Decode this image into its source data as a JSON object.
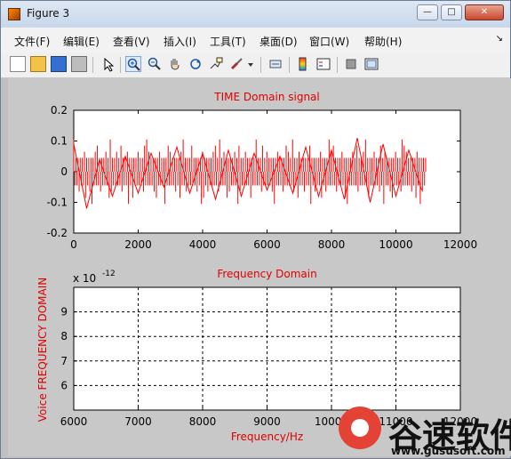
{
  "window": {
    "title": "Figure 3",
    "buttons": {
      "minimize": "—",
      "maximize": "□",
      "close": "✕"
    }
  },
  "menu": {
    "items": [
      "文件(F)",
      "编辑(E)",
      "查看(V)",
      "插入(I)",
      "工具(T)",
      "桌面(D)",
      "窗口(W)",
      "帮助(H)"
    ],
    "corner_icon": "↘"
  },
  "toolbar": {
    "items": [
      "new-file-icon",
      "open-folder-icon",
      "save-icon",
      "print-icon",
      "select-arrow-icon",
      "zoom-in-icon",
      "zoom-out-icon",
      "pan-icon",
      "rotate-icon",
      "data-cursor-icon",
      "brush-icon",
      "dropdown-icon",
      "link-icon",
      "colorbar-icon",
      "legend-icon",
      "hide-tools-icon",
      "dock-icon"
    ]
  },
  "chart_data": [
    {
      "type": "line",
      "title": "TIME Domain signal",
      "xlabel": "",
      "ylabel": "",
      "xlim": [
        0,
        12000
      ],
      "ylim": [
        -0.2,
        0.2
      ],
      "x_ticks": [
        "0",
        "2000",
        "4000",
        "6000",
        "8000",
        "10000",
        "12000"
      ],
      "y_ticks": [
        "-0.2",
        "-0.1",
        "0",
        "0.1",
        "0.2"
      ],
      "series": [
        {
          "color": "#ff0000",
          "x": [
            0,
            400,
            800,
            1200,
            1600,
            2000,
            2400,
            2800,
            3200,
            3600,
            4000,
            4400,
            4800,
            5200,
            5600,
            6000,
            6400,
            6800,
            7200,
            7600,
            8000,
            8400,
            8800,
            9200,
            9600,
            10000,
            10400,
            10800
          ],
          "y": [
            0.09,
            -0.12,
            0.04,
            -0.08,
            0.05,
            -0.07,
            0.06,
            -0.05,
            0.08,
            -0.07,
            0.06,
            -0.09,
            0.07,
            -0.08,
            0.06,
            -0.06,
            0.05,
            -0.07,
            0.08,
            -0.08,
            0.07,
            -0.09,
            0.11,
            -0.1,
            0.09,
            -0.08,
            0.07,
            -0.06
          ]
        }
      ]
    },
    {
      "type": "line",
      "title": "Frequency Domain",
      "xlabel": "Frequency/Hz",
      "ylabel": "Voice FREQUENCY DOMAIN",
      "xlim": [
        6000,
        12000
      ],
      "ylim": [
        5,
        10
      ],
      "x_ticks": [
        "6000",
        "7000",
        "8000",
        "9000",
        "10000",
        "11000",
        "12000"
      ],
      "y_ticks": [
        "6",
        "7",
        "8",
        "9"
      ],
      "grid": true,
      "exponent_label": "x 10",
      "exponent": "-12",
      "series": []
    }
  ],
  "watermark": {
    "text": "谷速软件",
    "url": "www.gususoft.com"
  }
}
